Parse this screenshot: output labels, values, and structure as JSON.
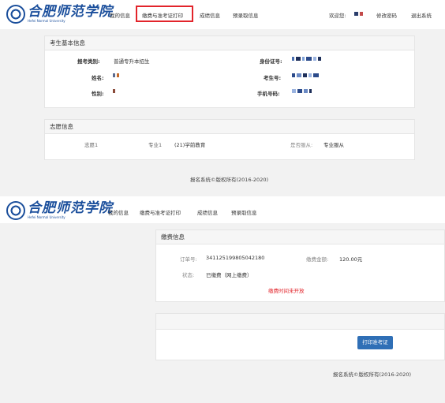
{
  "logo": {
    "name_cn": "合肥师范学院",
    "name_en": "Hefei Normal University"
  },
  "top": {
    "nav": {
      "my_info": "我的信息",
      "payment_ticket": "缴费与准考证打印",
      "scores": "成绩信息",
      "admission": "预录取信息",
      "welcome": "欢迎您:",
      "change_password": "修改密码",
      "logout": "退出系统"
    },
    "basic_info": {
      "title": "考生基本信息",
      "exam_type_label": "报考类别:",
      "exam_type_value": "普通专升本招生",
      "name_label": "姓名:",
      "gender_label": "性别:",
      "id_label": "身份证号:",
      "exam_no_label": "考生号:",
      "phone_label": "手机号码:"
    },
    "wish_info": {
      "title": "志愿信息",
      "wish_label": "志愿1",
      "major_label": "专业1",
      "major_value": "(21)学前教育",
      "obey_label": "是否服从:",
      "obey_value": "专业服从"
    },
    "footer": "报名系统©版权所有(2016-2020)"
  },
  "bottom": {
    "nav": {
      "my_info": "我的信息",
      "payment_ticket": "缴费与准考证打印",
      "scores": "成绩信息",
      "admission": "预录取信息"
    },
    "payment": {
      "title": "缴费信息",
      "order_label": "订单号:",
      "order_value": "341125199805042180",
      "amount_label": "缴费金额:",
      "amount_value": "120.00元",
      "status_label": "状态:",
      "status_value": "已缴费（网上缴费）",
      "notice": "缴费时间未开放"
    },
    "print_button": "打印准考证",
    "footer": "报名系统©版权所有(2016-2020)"
  },
  "colors": {
    "brand": "#1b4f9c",
    "highlight": "#e2242b",
    "button": "#2f6fb6"
  }
}
